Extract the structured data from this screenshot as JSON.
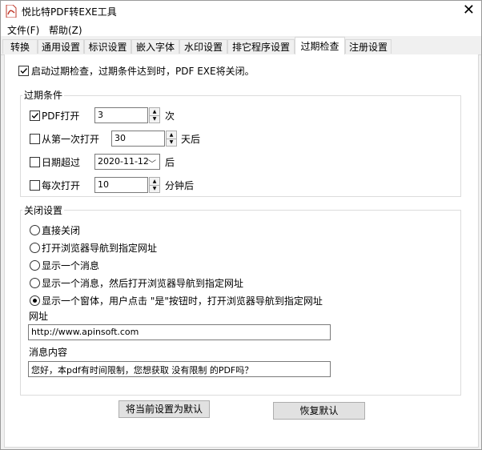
{
  "window": {
    "title": "悦比特PDF转EXE工具",
    "close": "✕"
  },
  "menu": [
    {
      "label": "文件(F)"
    },
    {
      "label": "帮助(Z)"
    }
  ],
  "tabs": [
    {
      "label": "转换"
    },
    {
      "label": "通用设置"
    },
    {
      "label": "标识设置"
    },
    {
      "label": "嵌入字体"
    },
    {
      "label": "水印设置"
    },
    {
      "label": "排它程序设置"
    },
    {
      "label": "过期检查",
      "active": true
    },
    {
      "label": "注册设置"
    }
  ],
  "enable_check": {
    "label": "启动过期检查，过期条件达到时，PDF EXE将关闭。",
    "checked": true
  },
  "conditions": {
    "legend": "过期条件",
    "pdf_open": {
      "label": "PDF打开",
      "checked": true,
      "value": "3",
      "unit": "次"
    },
    "first_open": {
      "label": "从第一次打开",
      "checked": false,
      "value": "30",
      "unit": "天后"
    },
    "date_exceed": {
      "label": "日期超过",
      "checked": false,
      "value": "2020-11-12",
      "unit": "后"
    },
    "each_open": {
      "label": "每次打开",
      "checked": false,
      "value": "10",
      "unit": "分钟后"
    }
  },
  "close_settings": {
    "legend": "关闭设置",
    "options": [
      {
        "label": "直接关闭",
        "selected": false
      },
      {
        "label": "打开浏览器导航到指定网址",
        "selected": false
      },
      {
        "label": "显示一个消息",
        "selected": false
      },
      {
        "label": "显示一个消息，然后打开浏览器导航到指定网址",
        "selected": false
      },
      {
        "label": "显示一个窗体，用户点击 \"是\"按钮时，打开浏览器导航到指定网址",
        "selected": true
      }
    ],
    "url_label": "网址",
    "url_value": "http://www.apinsoft.com",
    "message_label": "消息内容",
    "message_value": "您好，本pdf有时间限制，您想获取 没有限制 的PDF吗？"
  },
  "buttons": {
    "set_default": "将当前设置为默认",
    "restore_default": "恢复默认"
  },
  "icons": {
    "app": "pdf-icon",
    "check": "check-icon",
    "spin_up": "spin-up-icon",
    "spin_down": "spin-down-icon",
    "dropdown": "chevron-down-icon"
  }
}
